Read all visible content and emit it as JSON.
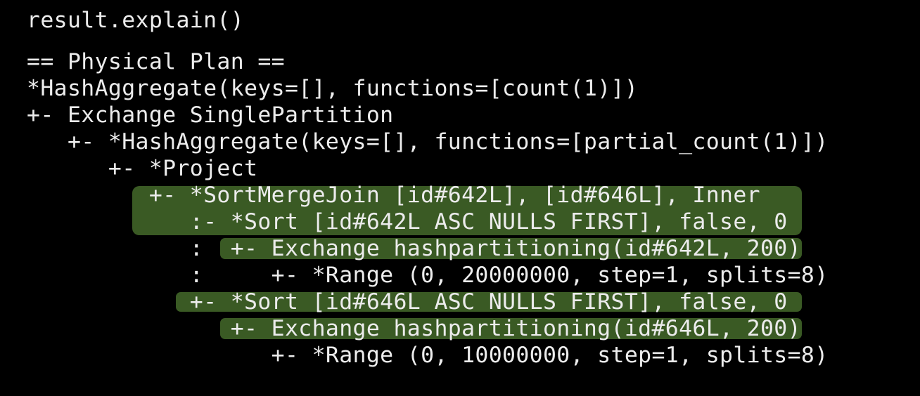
{
  "command": "result.explain()",
  "colors": {
    "background": "#000000",
    "text": "#ececec",
    "highlight": "#3a5a24"
  },
  "plan_lines": [
    "== Physical Plan ==",
    "*HashAggregate(keys=[], functions=[count(1)])",
    "+- Exchange SinglePartition",
    "   +- *HashAggregate(keys=[], functions=[partial_count(1)])",
    "      +- *Project",
    "         +- *SortMergeJoin [id#642L], [id#646L], Inner",
    "            :- *Sort [id#642L ASC NULLS FIRST], false, 0",
    "            :  +- Exchange hashpartitioning(id#642L, 200)",
    "            :     +- *Range (0, 20000000, step=1, splits=8)",
    "            +- *Sort [id#646L ASC NULLS FIRST], false, 0",
    "               +- Exchange hashpartitioning(id#646L, 200)",
    "                  +- *Range (0, 10000000, step=1, splits=8)"
  ]
}
